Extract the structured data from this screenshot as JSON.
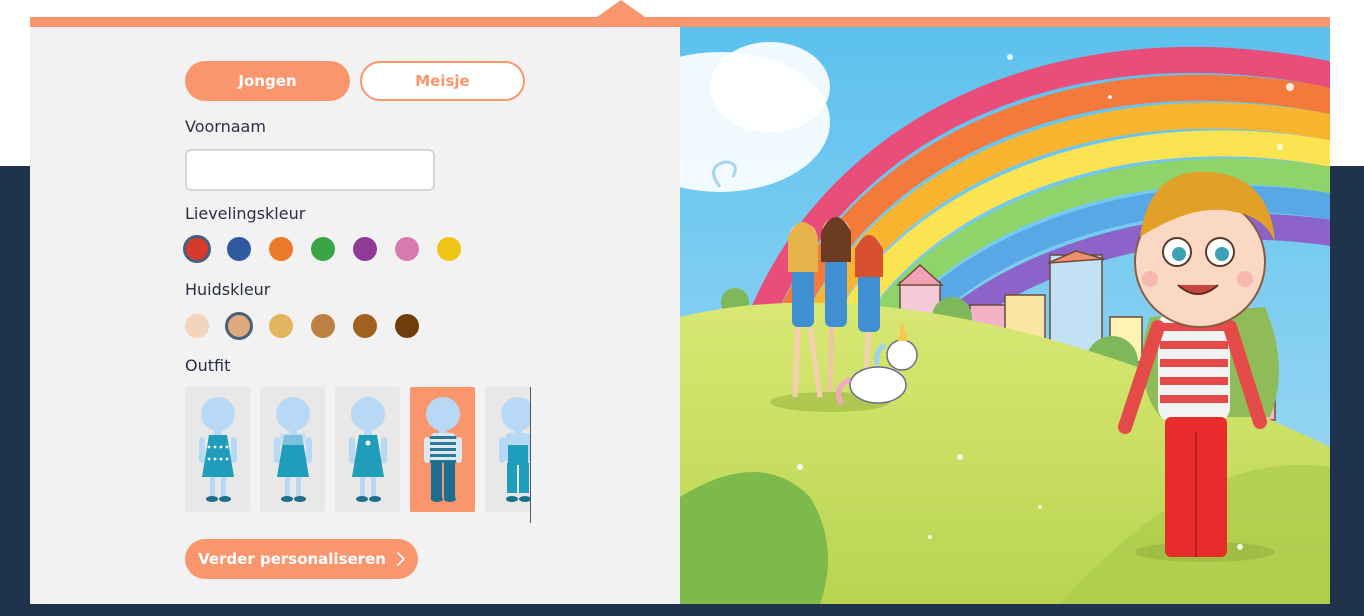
{
  "gender": {
    "boy_label": "Jongen",
    "girl_label": "Meisje",
    "selected": "Jongen"
  },
  "form": {
    "first_name_label": "Voornaam",
    "first_name_value": "",
    "favorite_color_label": "Lievelingskleur",
    "skin_color_label": "Huidskleur",
    "outfit_label": "Outfit",
    "continue_label": "Verder personaliseren"
  },
  "favorite_colors": [
    "#d63a2a",
    "#2f5aa0",
    "#ec7a26",
    "#3aa544",
    "#8e3a96",
    "#d77ab0",
    "#eec514"
  ],
  "favorite_color_selected": 0,
  "skin_colors": [
    "#f3d4bd",
    "#deaa7e",
    "#e2b65f",
    "#bd8042",
    "#a0621e",
    "#6f3c0b"
  ],
  "skin_color_selected": 1,
  "outfits": [
    {
      "name": "dotted-dress"
    },
    {
      "name": "pinafore-dress"
    },
    {
      "name": "heart-dress"
    },
    {
      "name": "striped-shirt-jeans"
    },
    {
      "name": "dungarees"
    }
  ],
  "outfit_selected": 3,
  "colors": {
    "accent": "#f9966e",
    "navy": "#1f334d",
    "panel": "#f2f2f2"
  },
  "icons": {
    "continue_arrow": "chevron-right-icon"
  }
}
